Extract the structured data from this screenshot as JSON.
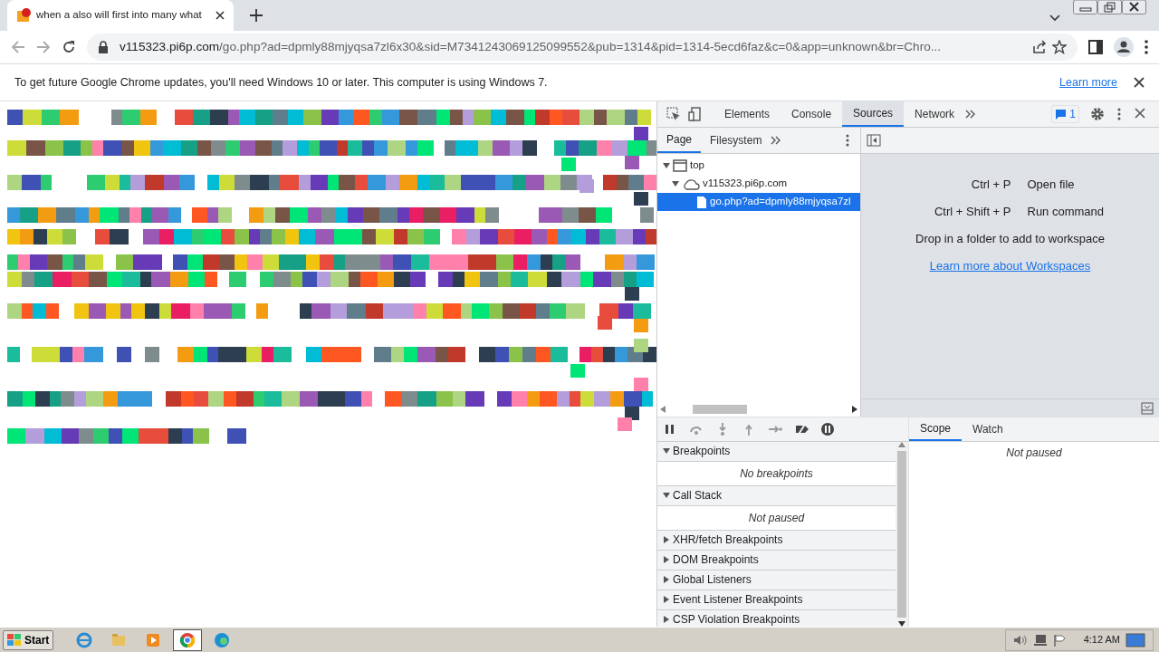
{
  "browser": {
    "tab": {
      "title": "when a also will first into many what",
      "selected": true
    },
    "address": {
      "host": "v115323.pi6p.com",
      "path": "/go.php?ad=dpmly88mjyqsa7zl6x30&sid=M7341243069125099552&pub=1314&pid=1314-5ecd6faz&c=0&app=unknown&br=Chro..."
    },
    "infobar": {
      "message": "To get future Google Chrome updates, you'll need Windows 10 or later. This computer is using Windows 7.",
      "link": "Learn more"
    }
  },
  "devtools": {
    "tabs": [
      {
        "label": "Elements",
        "selected": false
      },
      {
        "label": "Console",
        "selected": false
      },
      {
        "label": "Sources",
        "selected": true
      },
      {
        "label": "Network",
        "selected": false
      }
    ],
    "issues_badge": "1",
    "navigator_tabs": [
      {
        "label": "Page",
        "selected": true
      },
      {
        "label": "Filesystem",
        "selected": false
      }
    ],
    "tree": [
      {
        "label": "top",
        "kind": "frame",
        "expanded": true,
        "selected": false,
        "children": [
          {
            "label": "v115323.pi6p.com",
            "kind": "domain",
            "expanded": true,
            "selected": false,
            "children": [
              {
                "label": "go.php?ad=dpmly88mjyqsa7zl",
                "kind": "file",
                "selected": true
              }
            ]
          }
        ]
      }
    ],
    "shortcuts": [
      {
        "keys": "Ctrl + P",
        "action": "Open file"
      },
      {
        "keys": "Ctrl + Shift + P",
        "action": "Run command"
      }
    ],
    "drop_hint": "Drop in a folder to add to workspace",
    "workspace_link": "Learn more about Workspaces",
    "debugger_sections": [
      {
        "label": "Breakpoints",
        "expanded": true,
        "message": "No breakpoints"
      },
      {
        "label": "Call Stack",
        "expanded": true,
        "message": "Not paused"
      },
      {
        "label": "XHR/fetch Breakpoints",
        "expanded": false
      },
      {
        "label": "DOM Breakpoints",
        "expanded": false
      },
      {
        "label": "Global Listeners",
        "expanded": false
      },
      {
        "label": "Event Listener Breakpoints",
        "expanded": false
      },
      {
        "label": "CSP Violation Breakpoints",
        "expanded": false
      }
    ],
    "scope_tabs": [
      {
        "label": "Scope",
        "selected": true
      },
      {
        "label": "Watch",
        "selected": false
      }
    ],
    "scope_message": "Not paused"
  },
  "taskbar": {
    "start": "Start",
    "apps": [
      {
        "kind": "ie",
        "selected": false
      },
      {
        "kind": "explorer",
        "selected": false
      },
      {
        "kind": "media",
        "selected": false
      },
      {
        "kind": "chrome",
        "selected": true
      },
      {
        "kind": "edge",
        "selected": false
      }
    ],
    "clock": "4:12 AM"
  }
}
